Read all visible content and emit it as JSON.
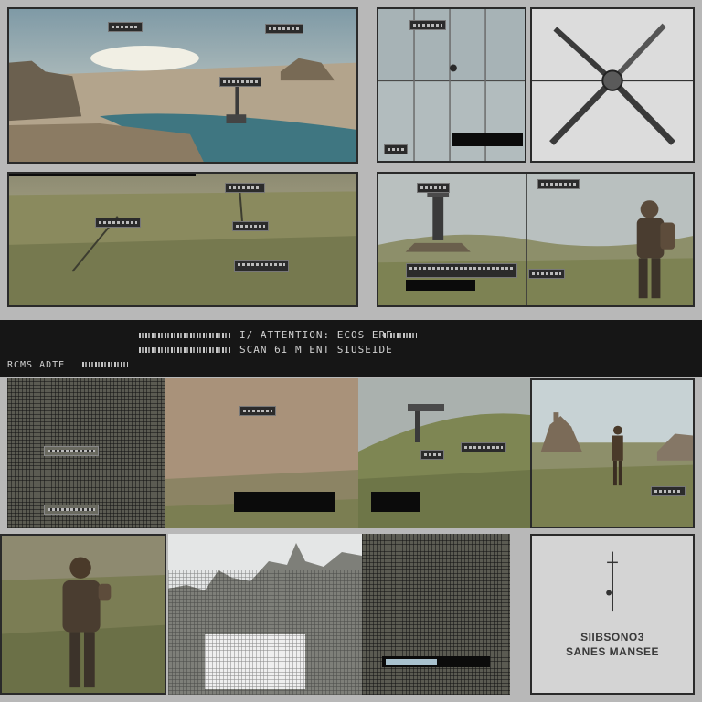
{
  "band": {
    "title_line": "I/ ATTENTION: ECOS  ERE",
    "sub_line": "   SCAN 6I  M  ENT  SIUSEIDE",
    "left_code": "RCMS ADTE"
  },
  "bottom_right_caption": {
    "line1": "SIIBSONO3",
    "line2": "SANES MANSEE"
  },
  "colors": {
    "frame_bg": "#b8b8b8",
    "panel_border": "#2a2a2a",
    "band_bg": "#161616",
    "sky": "#9db3bf",
    "grass": "#7f8154",
    "water": "#3f7681",
    "sand": "#a9927a"
  },
  "icons": [
    "wind-turbine-icon",
    "radio-tower-icon",
    "soldier-icon",
    "castle-icon"
  ]
}
